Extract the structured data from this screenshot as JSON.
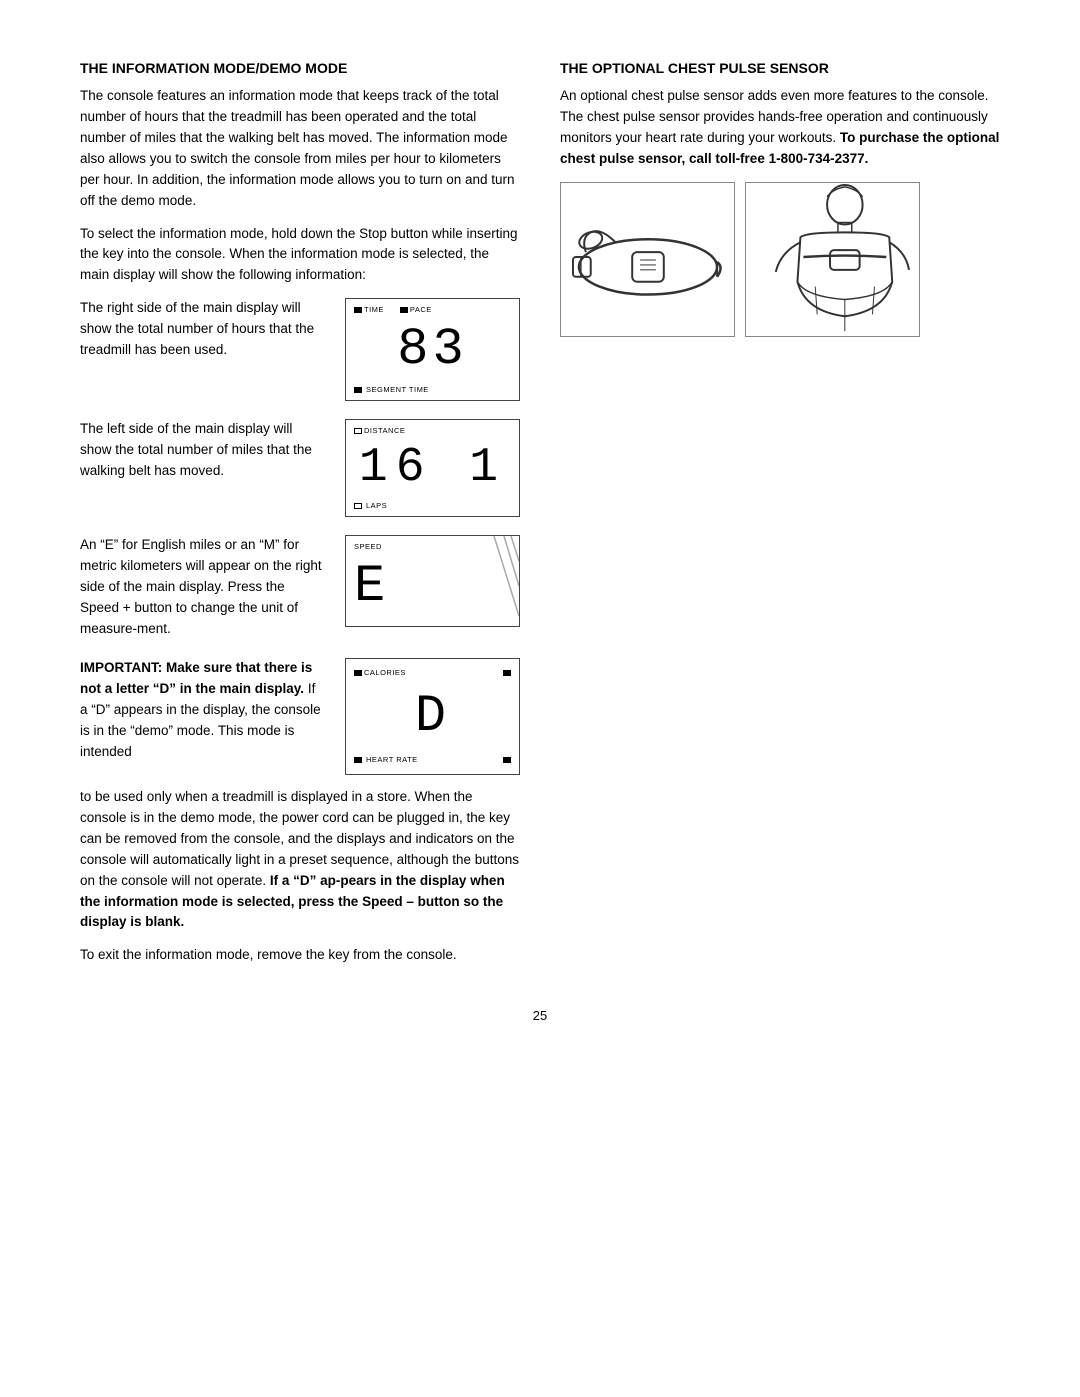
{
  "left_col": {
    "heading": "THE INFORMATION MODE/DEMO MODE",
    "para1": "The console features an information mode that keeps track of the total number of hours that the treadmill has been operated and the total number of miles that the walking belt has moved. The information mode also allows you to switch the console from miles per hour to kilometers per hour. In addition, the information mode allows you to turn on and turn off the demo mode.",
    "para2": "To select the information mode, hold down the Stop button while inserting the key into the console. When the information mode is selected, the main display will show the following information:",
    "display1": {
      "top_labels": [
        "TIME",
        "PACE"
      ],
      "number": "83",
      "bottom_label": "SEGMENT TIME",
      "text": "The right side of the main display will show the total number of hours that the treadmill has been used."
    },
    "display2": {
      "top_label": "DISTANCE",
      "number": "16 1",
      "bottom_label": "LAPS",
      "text": "The left side of the main display will show the total number of miles that the walking belt has moved."
    },
    "display3": {
      "top_label": "SPEED",
      "number": "E",
      "text": "An “E” for English miles or an “M” for metric kilometers will appear on the right side of the main display. Press the Speed + button to change the unit of measure-ment."
    },
    "important_label": "IMPORTANT: Make sure that there is not a letter “D” in the main display.",
    "important_text_before": "If a “D” appears in the display, the console is in the “demo” mode. This mode is intended",
    "display4": {
      "top_label_left": "CALORIES",
      "top_label_right": "",
      "number": "D",
      "bottom_label": "HEART RATE"
    },
    "para_after_display": "to be used only when a treadmill is displayed in a store. When the console is in the demo mode, the power cord can be plugged in, the key can be removed from the console, and the displays and indicators on the console will automatically light in a preset sequence, although the buttons on the console will not operate.",
    "bold_warning": "If a “D” ap-pears in the display when the information mode is selected, press the Speed – button so the display is blank.",
    "para_exit": "To exit the information mode, remove the key from the console."
  },
  "right_col": {
    "heading": "THE OPTIONAL CHEST PULSE SENSOR",
    "para1": "An optional chest pulse sensor adds even more features to the console. The chest pulse sensor provides hands-free operation and continuously monitors your heart rate during your workouts.",
    "bold_purchase": "To purchase the optional chest pulse sensor, call toll-free 1-800-734-2377."
  },
  "page_number": "25"
}
